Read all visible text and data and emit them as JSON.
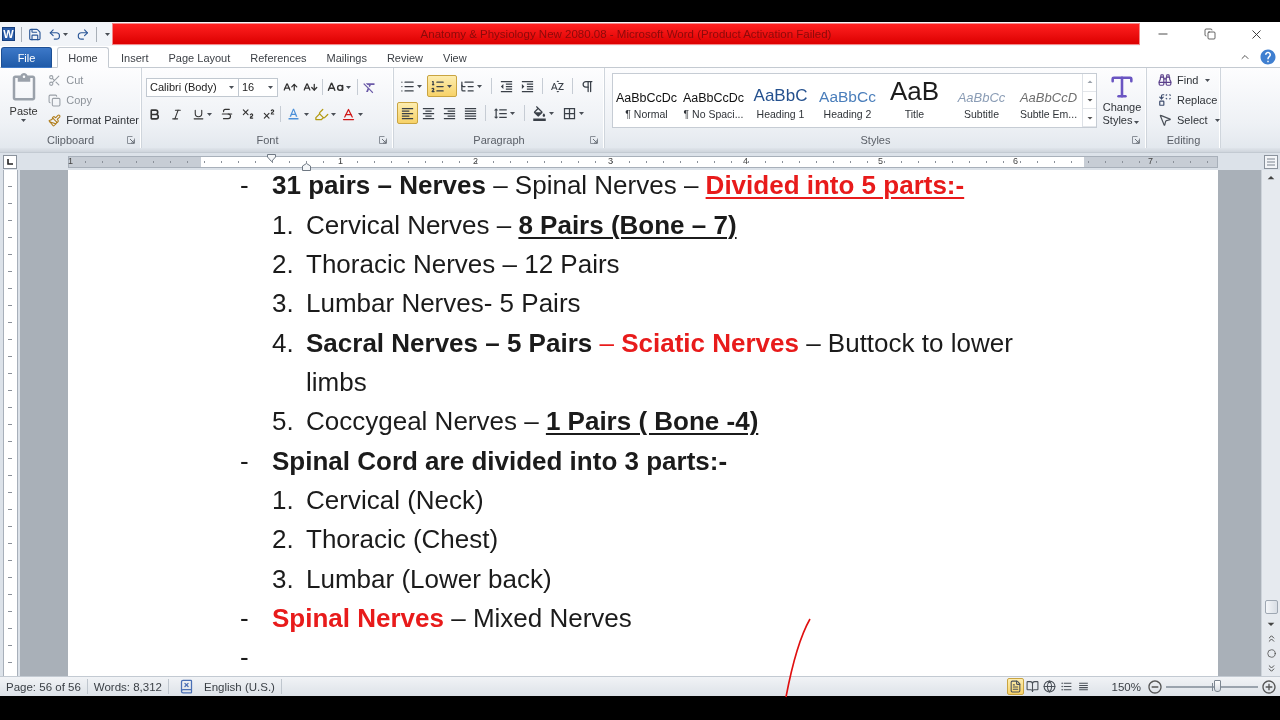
{
  "app_logo": "W",
  "window": {
    "title": "Anatomy & Physiology New 2080.08 - Microsoft Word (Product Activation Failed)"
  },
  "tabs": [
    {
      "label": "File",
      "kind": "backstage",
      "selected": false
    },
    {
      "label": "Home",
      "kind": "tab",
      "selected": true
    },
    {
      "label": "Insert",
      "kind": "tab",
      "selected": false
    },
    {
      "label": "Page Layout",
      "kind": "tab",
      "selected": false
    },
    {
      "label": "References",
      "kind": "tab",
      "selected": false
    },
    {
      "label": "Mailings",
      "kind": "tab",
      "selected": false
    },
    {
      "label": "Review",
      "kind": "tab",
      "selected": false
    },
    {
      "label": "View",
      "kind": "tab",
      "selected": false
    }
  ],
  "ribbon": {
    "clipboard": {
      "paste": "Paste",
      "actions": [
        {
          "kind": "cut",
          "label": "Cut",
          "disabled": true
        },
        {
          "kind": "copy",
          "label": "Copy",
          "disabled": true
        },
        {
          "kind": "format-painter",
          "label": "Format Painter",
          "disabled": false
        }
      ],
      "group_label": "Clipboard"
    },
    "font": {
      "name": "Calibri (Body)",
      "size": "16",
      "group_label": "Font"
    },
    "paragraph": {
      "row_1": [
        {
          "kind": "bullets",
          "selected": false
        },
        {
          "kind": "numbering",
          "selected": true
        },
        {
          "kind": "multilevel",
          "selected": false
        },
        {
          "kind": "decrease-indent",
          "selected": false
        },
        {
          "kind": "increase-indent",
          "selected": false
        },
        {
          "kind": "sort",
          "selected": false
        },
        {
          "kind": "show-marks",
          "selected": false
        }
      ],
      "row_2": [
        {
          "kind": "align-left",
          "selected": true
        },
        {
          "kind": "center",
          "selected": false
        },
        {
          "kind": "align-right",
          "selected": false
        },
        {
          "kind": "justify",
          "selected": false
        },
        {
          "kind": "line-spacing",
          "selected": false
        },
        {
          "kind": "shading",
          "selected": false
        },
        {
          "kind": "borders",
          "selected": false
        }
      ],
      "group_label": "Paragraph"
    },
    "styles": {
      "gallery": [
        {
          "preview": "AaBbCcDc",
          "name": "¶ Normal",
          "kind": "normal"
        },
        {
          "preview": "AaBbCcDc",
          "name": "¶ No Spaci...",
          "kind": "normal"
        },
        {
          "preview": "AaBbC",
          "name": "Heading 1",
          "kind": "heading-1"
        },
        {
          "preview": "AaBbCc",
          "name": "Heading 2",
          "kind": "heading-2"
        },
        {
          "preview": "AaB",
          "name": "Title",
          "kind": "title"
        },
        {
          "preview": "AaBbCc",
          "name": "Subtitle",
          "kind": "subtitle"
        },
        {
          "preview": "AaBbCcD",
          "name": "Subtle Em...",
          "kind": "emphasis"
        }
      ],
      "change_styles": "Change Styles",
      "group_label": "Styles"
    },
    "editing": {
      "actions": [
        {
          "kind": "find",
          "label": "Find"
        },
        {
          "kind": "replace",
          "label": "Replace"
        },
        {
          "kind": "select",
          "label": "Select"
        }
      ],
      "group_label": "Editing"
    }
  },
  "ruler": {
    "labels": [
      "1",
      "1",
      "2",
      "3",
      "4",
      "5",
      "6",
      "7"
    ]
  },
  "document": {
    "items": [
      {
        "marker": "-",
        "segments": [
          {
            "kind": "bold",
            "text": "31 pairs – Nerves"
          },
          {
            "kind": "plain",
            "text": " – Spinal Nerves – "
          },
          {
            "kind": "red-bold-underline",
            "text": "Divided into 5 parts:-"
          }
        ],
        "children": [
          {
            "marker": "1.",
            "segments": [
              {
                "kind": "plain",
                "text": "Cervical Nerves – "
              },
              {
                "kind": "bold-underline",
                "text": "8 Pairs (Bone – 7)"
              }
            ]
          },
          {
            "marker": "2.",
            "segments": [
              {
                "kind": "plain",
                "text": "Thoracic Nerves – 12 Pairs"
              }
            ]
          },
          {
            "marker": "3.",
            "segments": [
              {
                "kind": "plain",
                "text": "Lumbar Nerves- 5 Pairs"
              }
            ]
          },
          {
            "marker": "4.",
            "segments": [
              {
                "kind": "bold",
                "text": "Sacral Nerves – 5 Pairs"
              },
              {
                "kind": "red",
                "text": " – "
              },
              {
                "kind": "red-bold",
                "text": "Sciatic Nerves"
              },
              {
                "kind": "plain",
                "text": " – Buttock to lower limbs"
              }
            ]
          },
          {
            "marker": "5.",
            "segments": [
              {
                "kind": "plain",
                "text": "Coccygeal Nerves – "
              },
              {
                "kind": "bold-underline",
                "text": "1 Pairs ( Bone -4)"
              }
            ]
          }
        ]
      },
      {
        "marker": "-",
        "segments": [
          {
            "kind": "bold",
            "text": "Spinal Cord are divided into 3 parts:-"
          }
        ],
        "children": [
          {
            "marker": "1.",
            "segments": [
              {
                "kind": "plain",
                "text": "Cervical (Neck)"
              }
            ]
          },
          {
            "marker": "2.",
            "segments": [
              {
                "kind": "plain",
                "text": "Thoracic (Chest)"
              }
            ]
          },
          {
            "marker": "3.",
            "segments": [
              {
                "kind": "plain",
                "text": "Lumbar (Lower back)"
              }
            ]
          }
        ]
      },
      {
        "marker": "-",
        "segments": [
          {
            "kind": "red-bold",
            "text": "Spinal Nerves"
          },
          {
            "kind": "plain",
            "text": " – Mixed Nerves"
          }
        ]
      },
      {
        "marker": "-"
      }
    ]
  },
  "status_bar": {
    "page": "Page: 56 of 56",
    "words": "Words: 8,312",
    "language": "English (U.S.)",
    "views": [
      {
        "kind": "print-layout",
        "selected": true
      },
      {
        "kind": "full-screen-reading",
        "selected": false
      },
      {
        "kind": "web-layout",
        "selected": false
      },
      {
        "kind": "outline",
        "selected": false
      },
      {
        "kind": "draft",
        "selected": false
      }
    ],
    "zoom": {
      "label": "150%",
      "level": 0.55
    }
  }
}
